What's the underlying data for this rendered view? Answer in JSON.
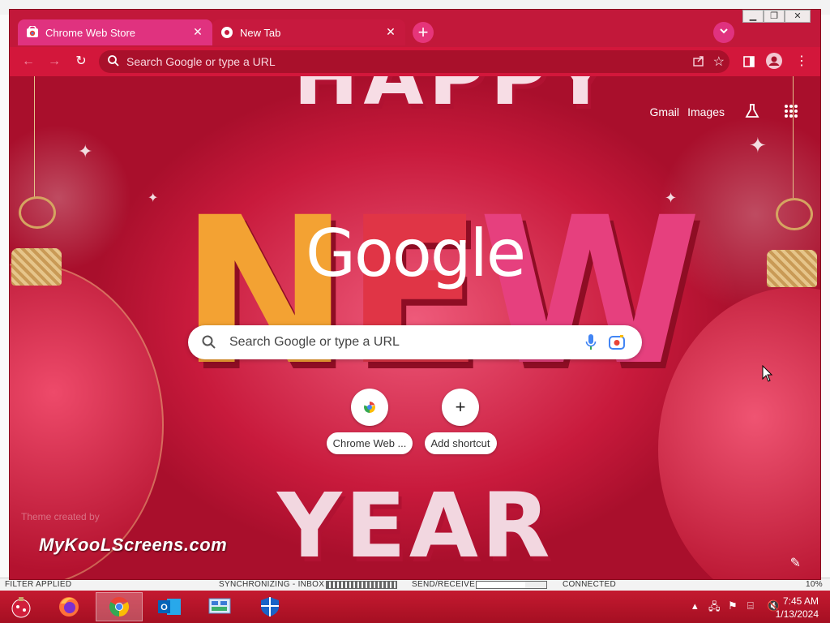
{
  "browser": {
    "tabs": [
      {
        "title": "Chrome Web Store",
        "icon": "chrome-web-store-icon"
      },
      {
        "title": "New Tab",
        "icon": "chrome-icon"
      }
    ],
    "omnibox_placeholder": "Search Google or type a URL"
  },
  "ntp": {
    "top_links": {
      "gmail": "Gmail",
      "images": "Images"
    },
    "logo": "Google",
    "search_placeholder": "Search Google or type a URL",
    "shortcuts": [
      {
        "label": "Chrome Web ...",
        "icon": "chrome-web-store-icon"
      },
      {
        "label": "Add shortcut",
        "icon": "plus-icon"
      }
    ],
    "theme_credit": "Theme created by",
    "watermark": "MyKooLScreens.com",
    "background_text": {
      "line1": "HAPPY",
      "line2_parts": [
        "N",
        "E",
        "W"
      ],
      "line3": "YEAR"
    }
  },
  "outlook_status": {
    "filter": "FILTER APPLIED",
    "sync": "SYNCHRONIZING - INBOX",
    "send": "SEND/RECEIVE",
    "connected": "CONNECTED",
    "zoom": "10%"
  },
  "taskbar": {
    "apps": [
      "firefox-icon",
      "chrome-icon",
      "outlook-icon",
      "network-manager-icon",
      "defender-shield-icon"
    ],
    "time": "7:45 AM",
    "date": "1/13/2024"
  },
  "colors": {
    "accent": "#c2183a",
    "tab_active": "#e0327f",
    "toolbar": "#d3173b"
  }
}
